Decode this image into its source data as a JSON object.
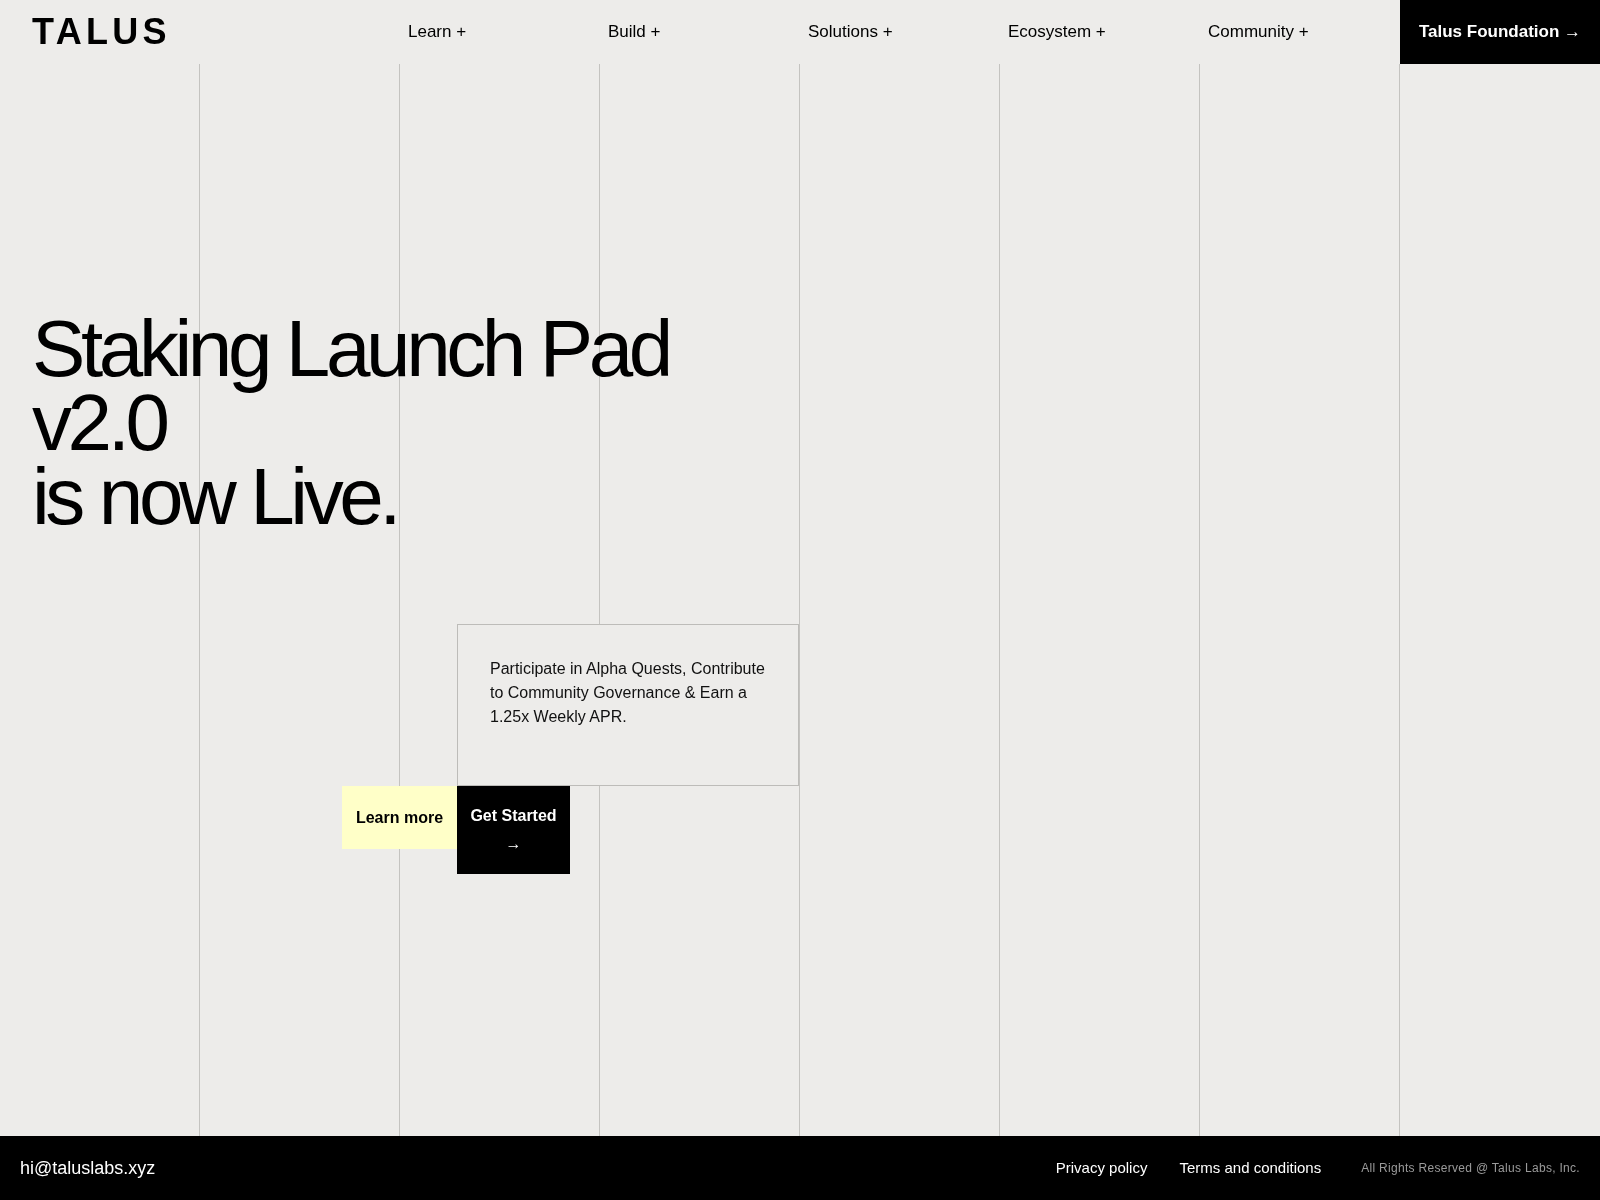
{
  "header": {
    "logo": "TALUS",
    "nav": [
      {
        "label": "Learn +"
      },
      {
        "label": "Build +"
      },
      {
        "label": "Solutions +"
      },
      {
        "label": "Ecosystem +"
      },
      {
        "label": "Community +"
      }
    ],
    "cta": "Talus Foundation →"
  },
  "hero": {
    "title_lines": [
      "Staking Launch Pad",
      "v2.0",
      "is now Live."
    ],
    "description": "Participate in Alpha Quests, Contribute to Community Governance & Earn a 1.25x Weekly APR.",
    "buttons": [
      {
        "label": "Learn more",
        "kind": "secondary"
      },
      {
        "label": "Get Started",
        "kind": "primary",
        "arrow": "→"
      }
    ]
  },
  "footer": {
    "email": "hi@taluslabs.xyz",
    "links": [
      "Privacy policy",
      "Terms and conditions"
    ],
    "copyright": "All Rights Reserved @ Talus Labs, Inc."
  }
}
